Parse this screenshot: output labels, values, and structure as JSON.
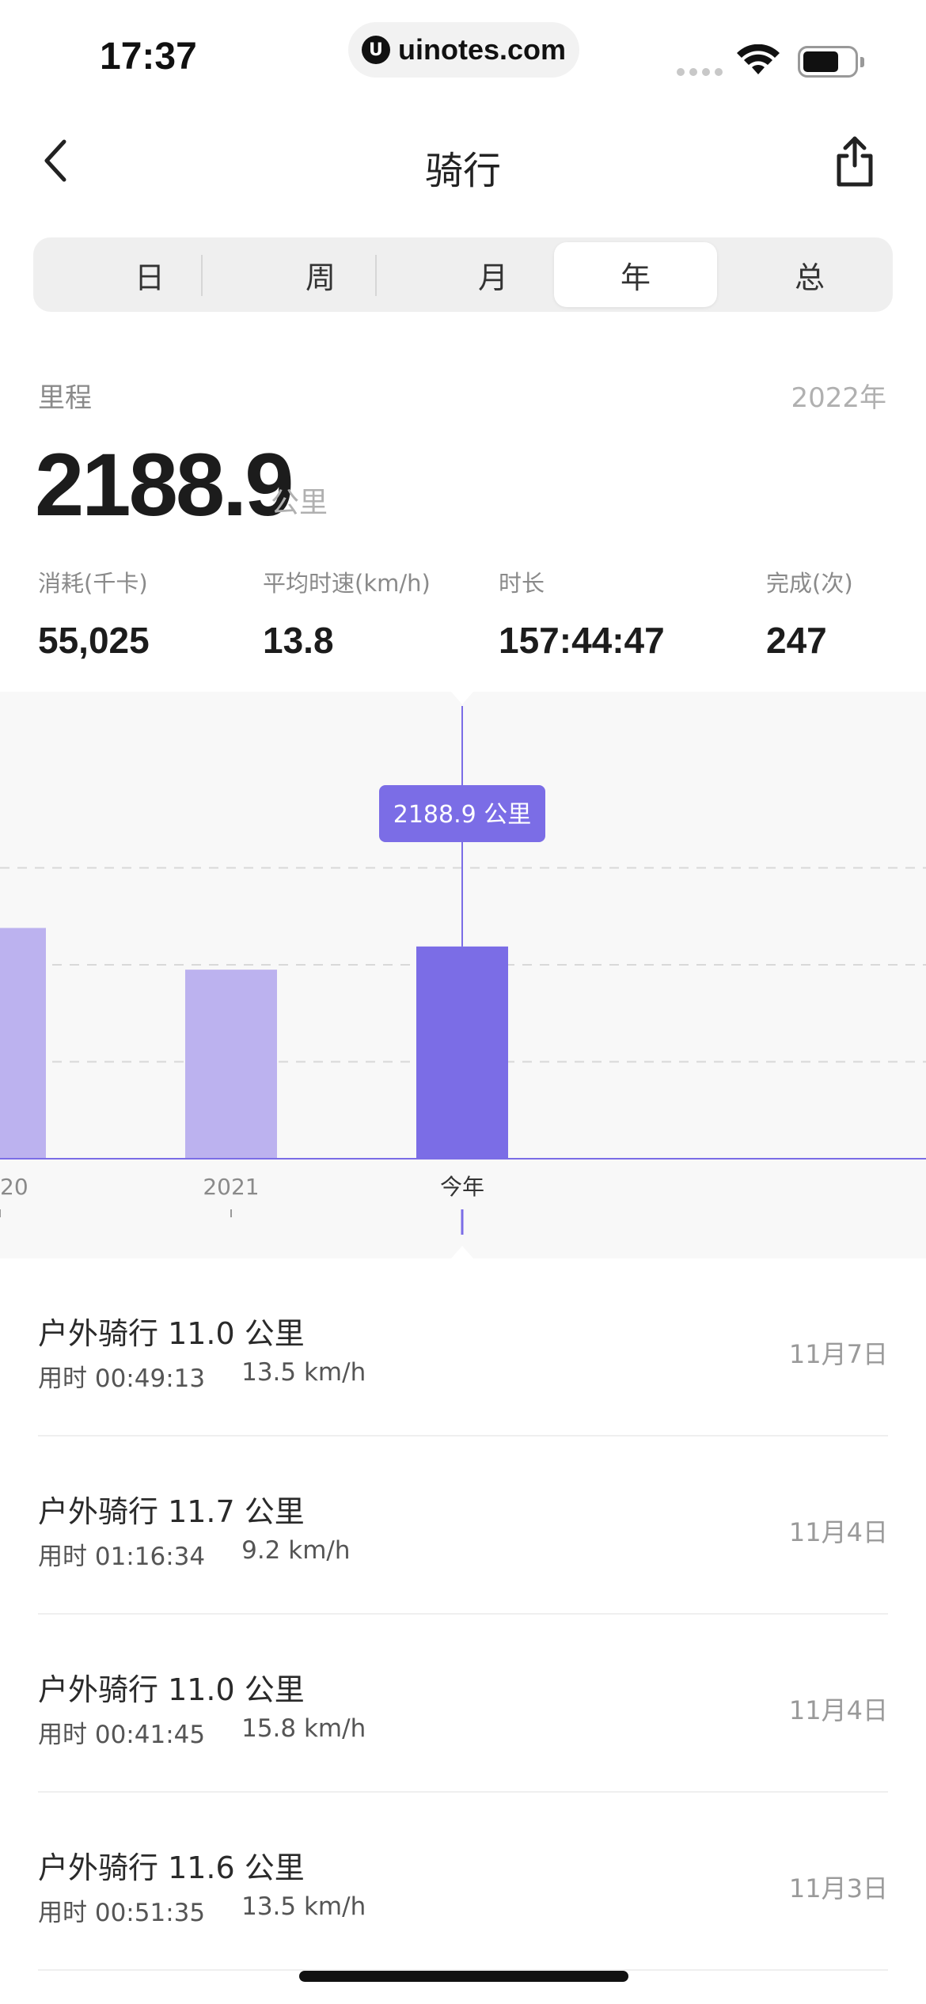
{
  "status_bar": {
    "time": "17:37",
    "url": "uinotes.com",
    "url_logo": "U"
  },
  "nav": {
    "title": "骑行",
    "back_icon": "chevron-left-icon",
    "share_icon": "share-icon"
  },
  "segmented": {
    "tabs": [
      "日",
      "周",
      "月",
      "年",
      "总"
    ],
    "selected": "年"
  },
  "summary": {
    "metric_label": "里程",
    "period_label": "2022年",
    "value": "2188.9",
    "unit": "公里",
    "stats": [
      {
        "label": "消耗(千卡)",
        "value": "55,025"
      },
      {
        "label": "平均时速(km/h)",
        "value": "13.8"
      },
      {
        "label": "时长",
        "value": "157:44:47"
      },
      {
        "label": "完成(次)",
        "value": "247"
      }
    ]
  },
  "chart_data": {
    "type": "bar",
    "categories": [
      "20",
      "2021",
      "今年"
    ],
    "values": [
      2380,
      1950,
      2188.9
    ],
    "selected_index": 2,
    "tooltip": "2188.9 公里",
    "ylim": [
      0,
      4000
    ],
    "grid": true,
    "colors": {
      "bar": "#bcb2ef",
      "bar_selected": "#7b6de6",
      "axis": "#7b6de6",
      "grid": "#d8d8d8",
      "tooltip_bg": "#7b6de6"
    }
  },
  "workouts": [
    {
      "title": "户外骑行 11.0 公里",
      "duration": "用时 00:49:13",
      "speed": "13.5 km/h",
      "date": "11月7日"
    },
    {
      "title": "户外骑行 11.7 公里",
      "duration": "用时 01:16:34",
      "speed": "9.2 km/h",
      "date": "11月4日"
    },
    {
      "title": "户外骑行 11.0 公里",
      "duration": "用时 00:41:45",
      "speed": "15.8 km/h",
      "date": "11月4日"
    },
    {
      "title": "户外骑行 11.6 公里",
      "duration": "用时 00:51:35",
      "speed": "13.5 km/h",
      "date": "11月3日"
    }
  ]
}
